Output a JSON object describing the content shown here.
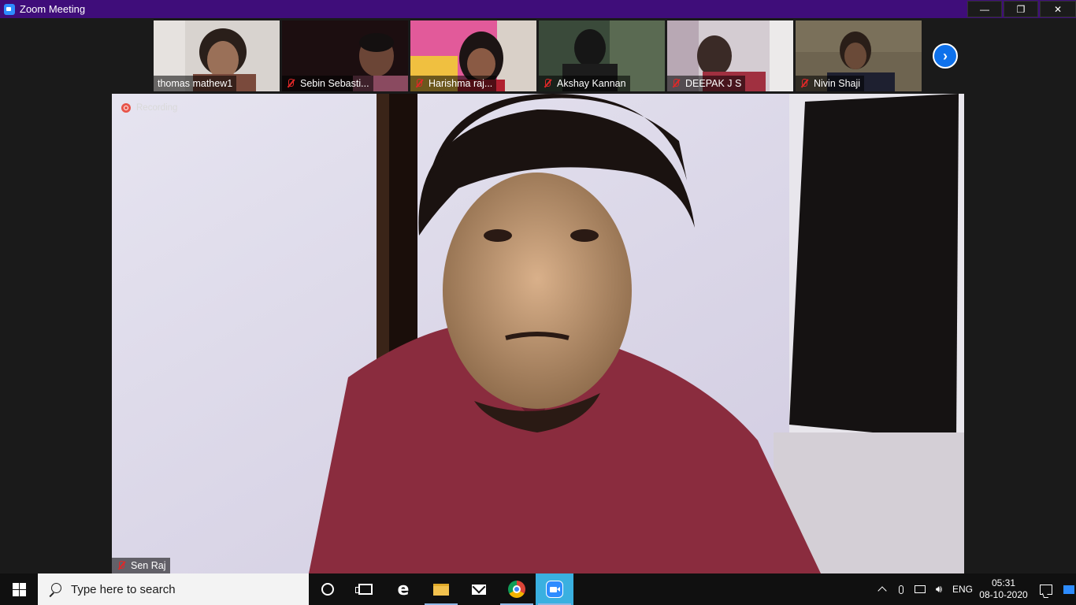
{
  "window": {
    "title": "Zoom Meeting",
    "minimize_glyph": "—",
    "restore_glyph": "❐",
    "close_glyph": "✕"
  },
  "gallery": {
    "participants": [
      {
        "name": "thomas mathew1",
        "muted": false,
        "bg": "#c9c4c0"
      },
      {
        "name": "Sebin Sebasti...",
        "muted": true,
        "bg": "#2a1416"
      },
      {
        "name": "Harishma raj...",
        "muted": true,
        "bg": "#e0609a"
      },
      {
        "name": "Akshay Kannan",
        "muted": true,
        "bg": "#2b3a2a"
      },
      {
        "name": "DEEPAK J S",
        "muted": true,
        "bg": "#cfc7cd"
      },
      {
        "name": "Nivin Shaji",
        "muted": true,
        "bg": "#6e6450"
      }
    ],
    "next_page_icon": "chevron-right-icon"
  },
  "main": {
    "recording_label": "Recording",
    "speaker_name": "Sen Raj",
    "speaker_muted": true
  },
  "taskbar": {
    "search_placeholder": "Type here to search",
    "pinned": [
      "cortana-icon",
      "task-view-icon",
      "edge-icon",
      "file-explorer-icon",
      "mail-icon",
      "chrome-icon",
      "zoom-icon"
    ],
    "language": "ENG",
    "time": "05:31",
    "date": "08-10-2020"
  }
}
